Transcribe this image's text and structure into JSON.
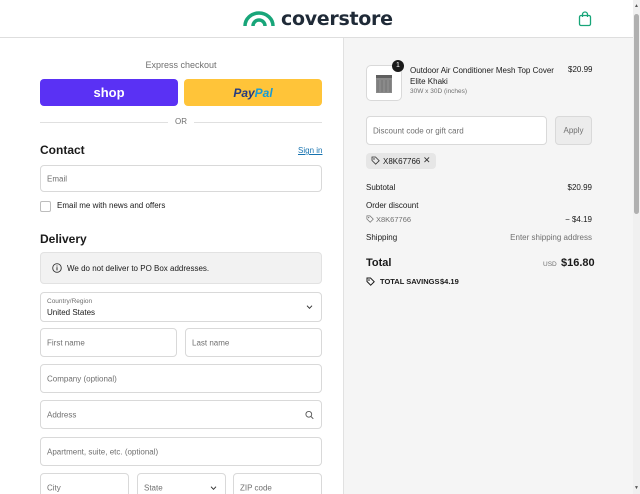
{
  "header": {
    "brand": "coverstore",
    "brand_color": "#18a579",
    "cart_icon": "shopping-bag-icon"
  },
  "express": {
    "title": "Express checkout",
    "shop_label": "shop",
    "paypal_part1": "Pay",
    "paypal_part2": "Pal",
    "or_label": "OR"
  },
  "contact": {
    "title": "Contact",
    "sign_in": "Sign in",
    "email_placeholder": "Email",
    "newsletter_label": "Email me with news and offers"
  },
  "delivery": {
    "title": "Delivery",
    "notice": "We do not deliver to PO Box addresses.",
    "country_label": "Country/Region",
    "country_value": "United States",
    "first_name": "First name",
    "last_name": "Last name",
    "company": "Company (optional)",
    "address": "Address",
    "apartment": "Apartment, suite, etc. (optional)",
    "city": "City",
    "state": "State",
    "zip": "ZIP code"
  },
  "order": {
    "item_name": "Outdoor Air Conditioner Mesh Top Cover Elite Khaki",
    "item_variant": "30W x 30D (inches)",
    "item_price": "$20.99",
    "quantity": "1",
    "discount_placeholder": "Discount code or gift card",
    "apply_label": "Apply",
    "applied_code": "X8K67766",
    "subtotal_label": "Subtotal",
    "subtotal_value": "$20.99",
    "order_discount_label": "Order discount",
    "discount_code": "X8K67766",
    "discount_value": "− $4.19",
    "shipping_label": "Shipping",
    "shipping_value": "Enter shipping address",
    "total_label": "Total",
    "currency": "USD",
    "total_value": "$16.80",
    "savings_label": "TOTAL SAVINGS",
    "savings_value": "$4.19"
  }
}
